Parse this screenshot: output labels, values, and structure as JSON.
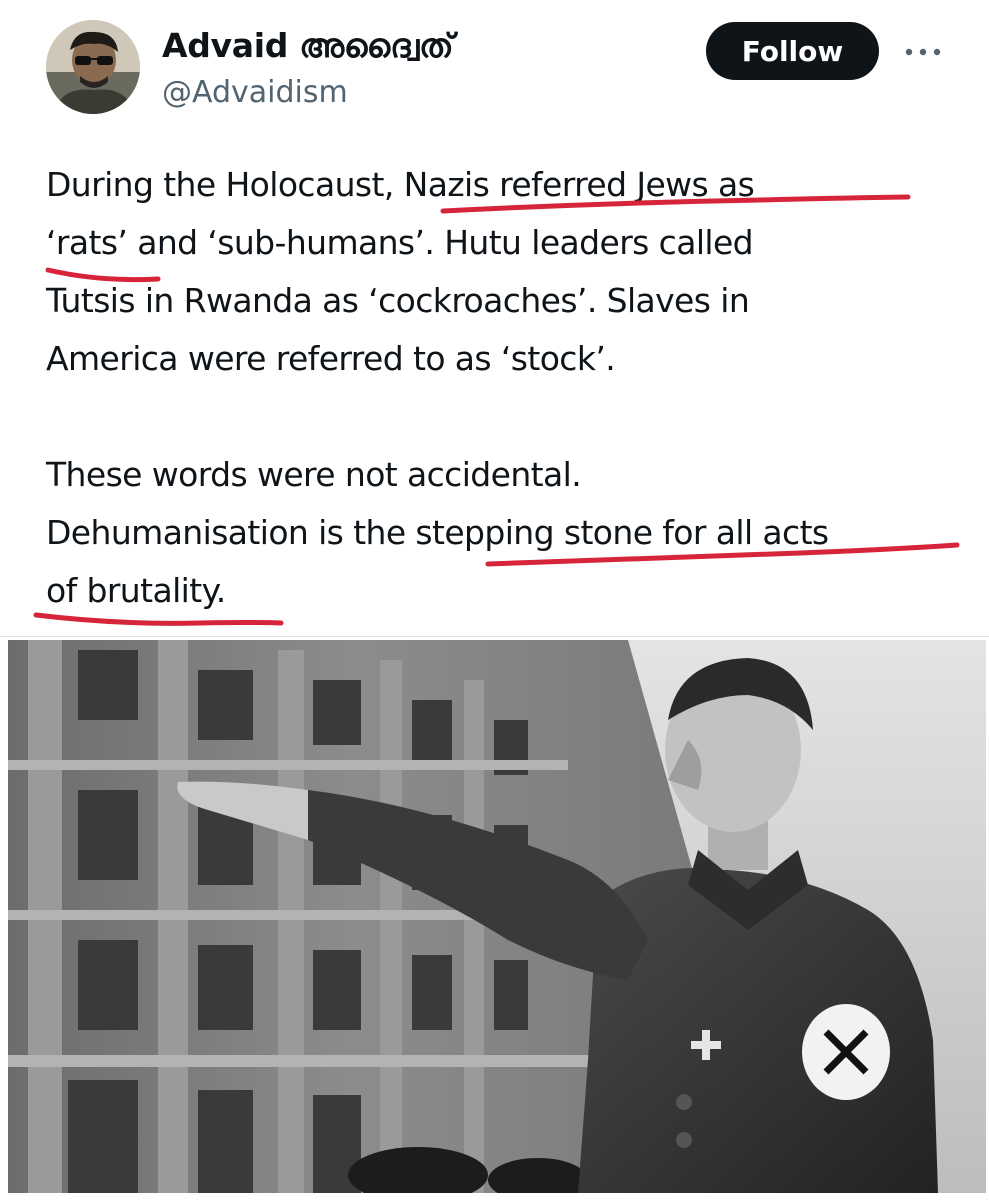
{
  "author": {
    "display_name": "Advaid അദ്വൈത്",
    "handle": "@Advaidism"
  },
  "actions": {
    "follow_label": "Follow",
    "more_icon": "more-horizontal-icon"
  },
  "tweet": {
    "paragraph1_lines": [
      "During the Holocaust, Nazis referred Jews as",
      "‘rats’ and ‘sub-humans’. Hutu leaders called",
      "Tutsis in Rwanda as ‘cockroaches’. Slaves in",
      "America were referred to as ‘stock’."
    ],
    "paragraph2_lines": [
      "These words were not accidental.",
      "Dehumanisation is the stepping stone for all acts",
      "of brutality."
    ]
  },
  "annotation_color": "#d6253a"
}
